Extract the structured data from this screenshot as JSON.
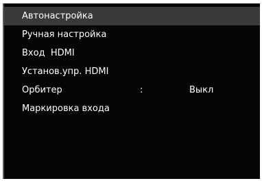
{
  "menu": {
    "items": [
      {
        "label": "Автонастройка",
        "selected": true
      },
      {
        "label": "Ручная настройка"
      },
      {
        "label": "Вход  HDMI"
      },
      {
        "label": "Установ.упр. HDMI"
      },
      {
        "label": "Орбитер",
        "separator": ":",
        "value": "Выкл"
      },
      {
        "label": "Маркировка входа"
      }
    ]
  },
  "colors": {
    "background": "#050505",
    "selected_row": "#3a3a3a",
    "text": "#ffffff"
  }
}
